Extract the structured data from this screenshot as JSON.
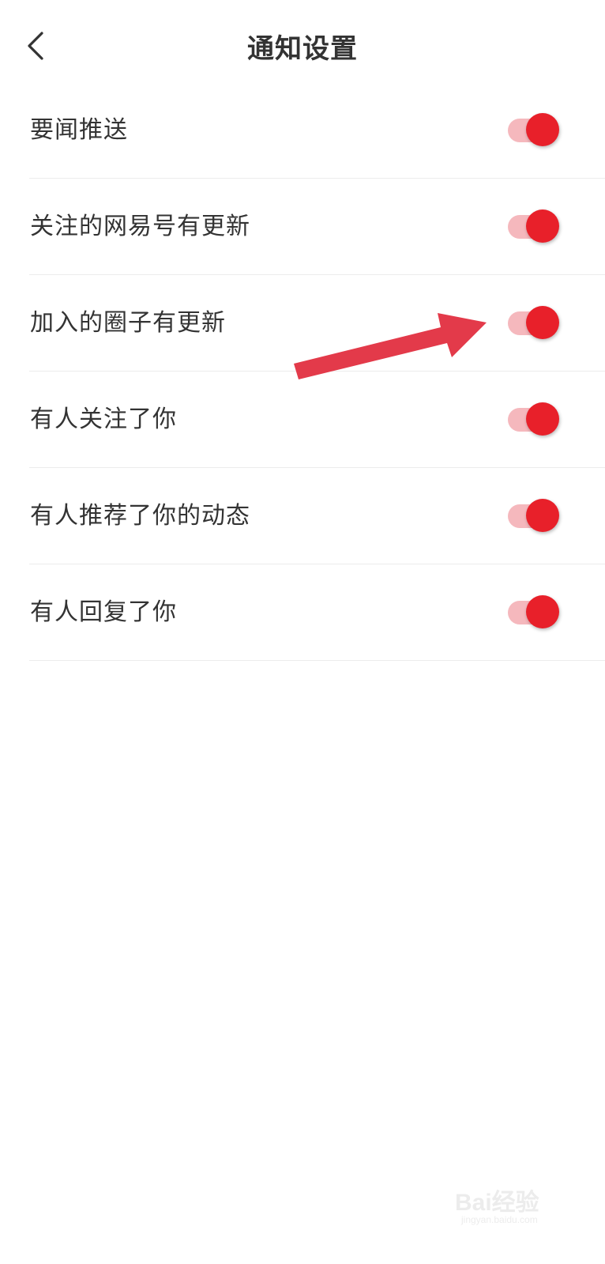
{
  "header": {
    "title": "通知设置",
    "back_icon": "chevron-left-icon"
  },
  "settings": [
    {
      "label": "要闻推送",
      "enabled": true
    },
    {
      "label": "关注的网易号有更新",
      "enabled": true
    },
    {
      "label": "加入的圈子有更新",
      "enabled": true
    },
    {
      "label": "有人关注了你",
      "enabled": true
    },
    {
      "label": "有人推荐了你的动态",
      "enabled": true
    },
    {
      "label": "有人回复了你",
      "enabled": true
    }
  ],
  "colors": {
    "accent": "#e8202a",
    "track_on": "#f5b8bd",
    "annotation_arrow": "#e33a4a"
  },
  "watermark": {
    "text": "Bai经验",
    "sub": "jingyan.baidu.com"
  }
}
